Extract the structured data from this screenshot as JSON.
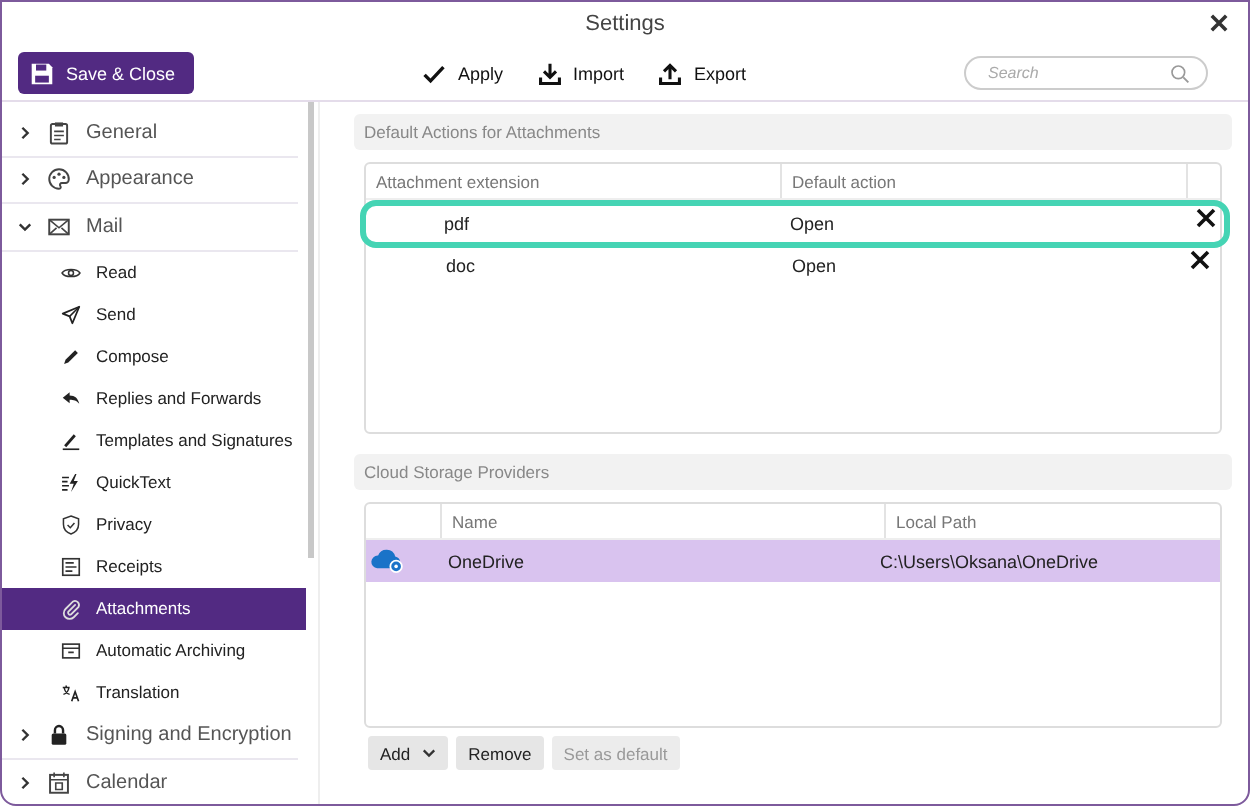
{
  "window": {
    "title": "Settings"
  },
  "toolbar": {
    "save_button": "Save & Close",
    "actions": [
      {
        "label": "Apply"
      },
      {
        "label": "Import"
      },
      {
        "label": "Export"
      }
    ],
    "search": {
      "placeholder": "Search"
    }
  },
  "sidebar": {
    "items": [
      {
        "label": "General",
        "expanded": false,
        "selected": false
      },
      {
        "label": "Appearance",
        "expanded": false,
        "selected": false
      },
      {
        "label": "Mail",
        "expanded": true,
        "selected": false,
        "children": [
          {
            "label": "Read",
            "selected": false
          },
          {
            "label": "Send",
            "selected": false
          },
          {
            "label": "Compose",
            "selected": false
          },
          {
            "label": "Replies and Forwards",
            "selected": false
          },
          {
            "label": "Templates and Signatures",
            "selected": false
          },
          {
            "label": "QuickText",
            "selected": false
          },
          {
            "label": "Privacy",
            "selected": false
          },
          {
            "label": "Receipts",
            "selected": false
          },
          {
            "label": "Attachments",
            "selected": true
          },
          {
            "label": "Automatic Archiving",
            "selected": false
          },
          {
            "label": "Translation",
            "selected": false
          }
        ]
      },
      {
        "label": "Signing and Encryption",
        "expanded": false,
        "selected": false
      },
      {
        "label": "Calendar",
        "expanded": false,
        "selected": false
      }
    ]
  },
  "attachments": {
    "title": "Default Actions for Attachments",
    "columns": [
      "Attachment extension",
      "Default action"
    ],
    "rows": [
      {
        "extension": "pdf",
        "action": "Open",
        "focused": true
      },
      {
        "extension": "doc",
        "action": "Open",
        "focused": false
      }
    ]
  },
  "cloud": {
    "title": "Cloud Storage Providers",
    "columns": [
      "Name",
      "Local Path"
    ],
    "rows": [
      {
        "name": "OneDrive",
        "path": "C:\\Users\\Oksana\\OneDrive",
        "selected": true
      }
    ],
    "buttons": [
      {
        "label": "Add",
        "kind": "dropdown",
        "disabled": false
      },
      {
        "label": "Remove",
        "kind": "plain",
        "disabled": false
      },
      {
        "label": "Set as default",
        "kind": "plain",
        "disabled": true
      }
    ]
  }
}
